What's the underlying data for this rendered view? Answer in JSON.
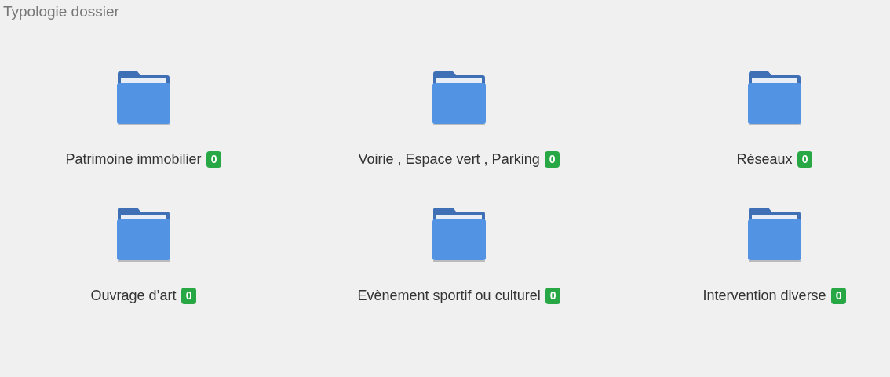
{
  "title": "Typologie dossier",
  "folders": [
    {
      "label": "Patrimoine immobilier",
      "count": "0"
    },
    {
      "label": "Voirie , Espace vert , Parking",
      "count": "0"
    },
    {
      "label": "Réseaux",
      "count": "0"
    },
    {
      "label": "Ouvrage d’art",
      "count": "0"
    },
    {
      "label": "Evènement sportif ou culturel",
      "count": "0"
    },
    {
      "label": "Intervention diverse",
      "count": "0"
    }
  ]
}
